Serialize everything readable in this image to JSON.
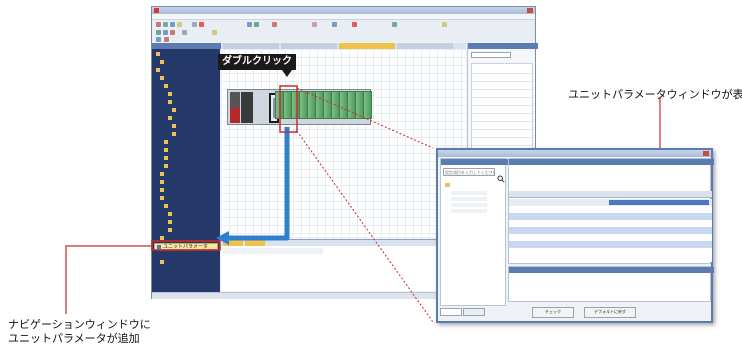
{
  "annotations": {
    "double_click": "ダブルクリック",
    "unit_param_window_shown": "ユニットパラメータウィンドウが表示",
    "nav_added_line1": "ナビゲーションウィンドウに",
    "nav_added_line2": "ユニットパラメータが追加"
  },
  "navigation": {
    "highlighted_item": "ユニットパラメータ"
  },
  "unit_param_window": {
    "search_placeholder": "設定項目を入力してください",
    "buttons": {
      "check": "チェック",
      "restore_default": "デフォルトに戻す"
    }
  },
  "colors": {
    "nav_panel": "#24386a",
    "arrow_blue": "#2f7fd0",
    "callout_red": "#cc2a2a",
    "highlight_yellow": "#f6e7a8",
    "table_header_blue": "#4a78c0",
    "row_blue": "#c8d8f2"
  },
  "icons": [
    "search-icon",
    "folder-icon",
    "gear-icon",
    "close-icon"
  ]
}
